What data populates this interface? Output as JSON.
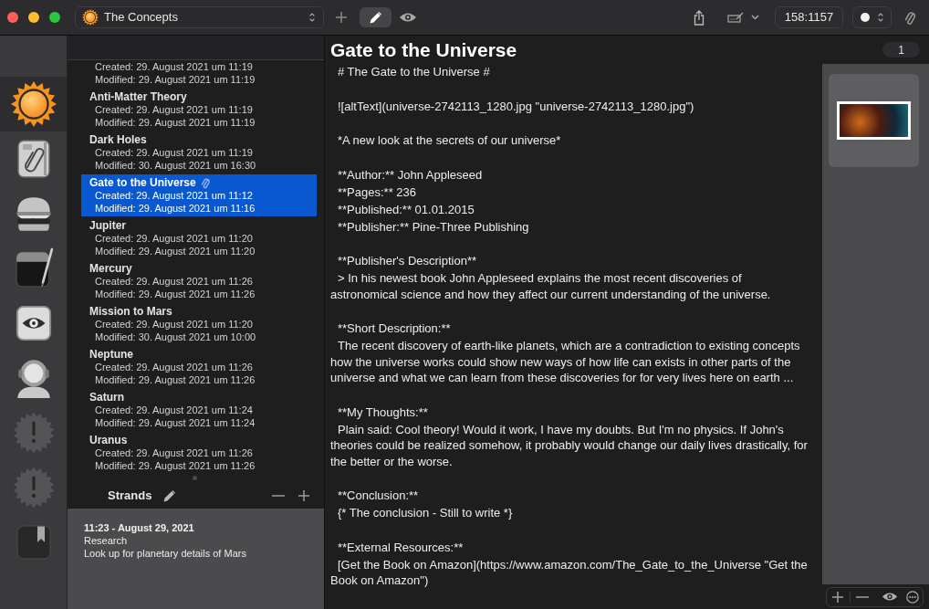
{
  "toolbar": {
    "collection": "The Concepts",
    "modes": [
      {
        "kind": "edit",
        "selected": true
      },
      {
        "kind": "preview",
        "selected": false
      }
    ],
    "position": "158:1157"
  },
  "sidebar": {
    "items": [
      {
        "kind": "sun",
        "selected": true
      },
      {
        "kind": "notebook",
        "selected": false
      },
      {
        "kind": "burger",
        "selected": false
      },
      {
        "kind": "notepad",
        "selected": false
      },
      {
        "kind": "eye",
        "selected": false
      },
      {
        "kind": "astronaut",
        "selected": false
      },
      {
        "kind": "alert",
        "selected": false
      },
      {
        "kind": "alert",
        "selected": false
      },
      {
        "kind": "bookmark",
        "selected": false
      }
    ]
  },
  "notes": [
    {
      "created": "Created: 29. August 2021 um 11:19",
      "modified": "Modified: 29. August 2021 um 11:19",
      "selected": false
    },
    {
      "title": "Anti-Matter Theory",
      "created": "Created: 29. August 2021 um 11:19",
      "modified": "Modified: 29. August 2021 um 11:19",
      "selected": false,
      "attachment": false
    },
    {
      "title": "Dark Holes",
      "created": "Created: 29. August 2021 um 11:19",
      "modified": "Modified: 30. August 2021 um 16:30",
      "selected": false,
      "attachment": false
    },
    {
      "title": "Gate to the Universe",
      "created": "Created: 29. August 2021 um 11:12",
      "modified": "Modified: 29. August 2021 um 11:16",
      "selected": true,
      "attachment": true
    },
    {
      "title": "Jupiter",
      "created": "Created: 29. August 2021 um 11:20",
      "modified": "Modified: 29. August 2021 um 11:20",
      "selected": false,
      "attachment": false
    },
    {
      "title": "Mercury",
      "created": "Created: 29. August 2021 um 11:26",
      "modified": "Modified: 29. August 2021 um 11:26",
      "selected": false,
      "attachment": false
    },
    {
      "title": "Mission to Mars",
      "created": "Created: 29. August 2021 um 11:20",
      "modified": "Modified: 30. August 2021 um 10:00",
      "selected": false,
      "attachment": false
    },
    {
      "title": "Neptune",
      "created": "Created: 29. August 2021 um 11:26",
      "modified": "Modified: 29. August 2021 um 11:26",
      "selected": false,
      "attachment": false
    },
    {
      "title": "Saturn",
      "created": "Created: 29. August 2021 um 11:24",
      "modified": "Modified: 29. August 2021 um 11:24",
      "selected": false,
      "attachment": false
    },
    {
      "title": "Uranus",
      "created": "Created: 29. August 2021 um 11:26",
      "modified": "Modified: 29. August 2021 um 11:26",
      "selected": false,
      "attachment": false
    }
  ],
  "strands": {
    "title": "Strands",
    "entries": [
      {
        "time": "11:23 - August 29, 2021",
        "category": "Research",
        "note": "Look up for planetary details of Mars"
      }
    ]
  },
  "editor": {
    "title": "Gate to the Universe",
    "blocks": [
      [
        "# The Gate to the Universe #"
      ],
      [
        "![altText](universe-2742113_1280.jpg \"universe-2742113_1280.jpg\")"
      ],
      [
        "*A new look at the secrets of our universe*"
      ],
      [
        "**Author:** John Appleseed",
        "**Pages:** 236",
        "**Published:** 01.01.2015",
        "**Publisher:** Pine-Three Publishing"
      ],
      [
        "**Publisher's Description**",
        "> In his newest book John Appleseed explains the most recent discoveries of astronomical science and how they affect our current understanding of the universe."
      ],
      [
        "**Short Description:**",
        "The recent discovery of earth-like planets, which are a contradiction to existing concepts how the universe works could show new ways of how life can exists in other parts of the universe and what we can learn from these discoveries for for very lives here on earth ..."
      ],
      [
        "**My Thoughts:**",
        "Plain said: Cool theory! Would it work, I have my doubts. But I'm no physics. If John's theories could be realized somehow, it probably would change our daily lives drastically, for the better or the worse."
      ],
      [
        "**Conclusion:**",
        "{* The conclusion - Still to write *}"
      ],
      [
        "**External Resources:**",
        "[Get the Book on Amazon](https://www.amazon.com/The_Gate_to_the_Universe \"Get the Book on Amazon\")"
      ]
    ]
  },
  "attachments": {
    "count": "1"
  }
}
